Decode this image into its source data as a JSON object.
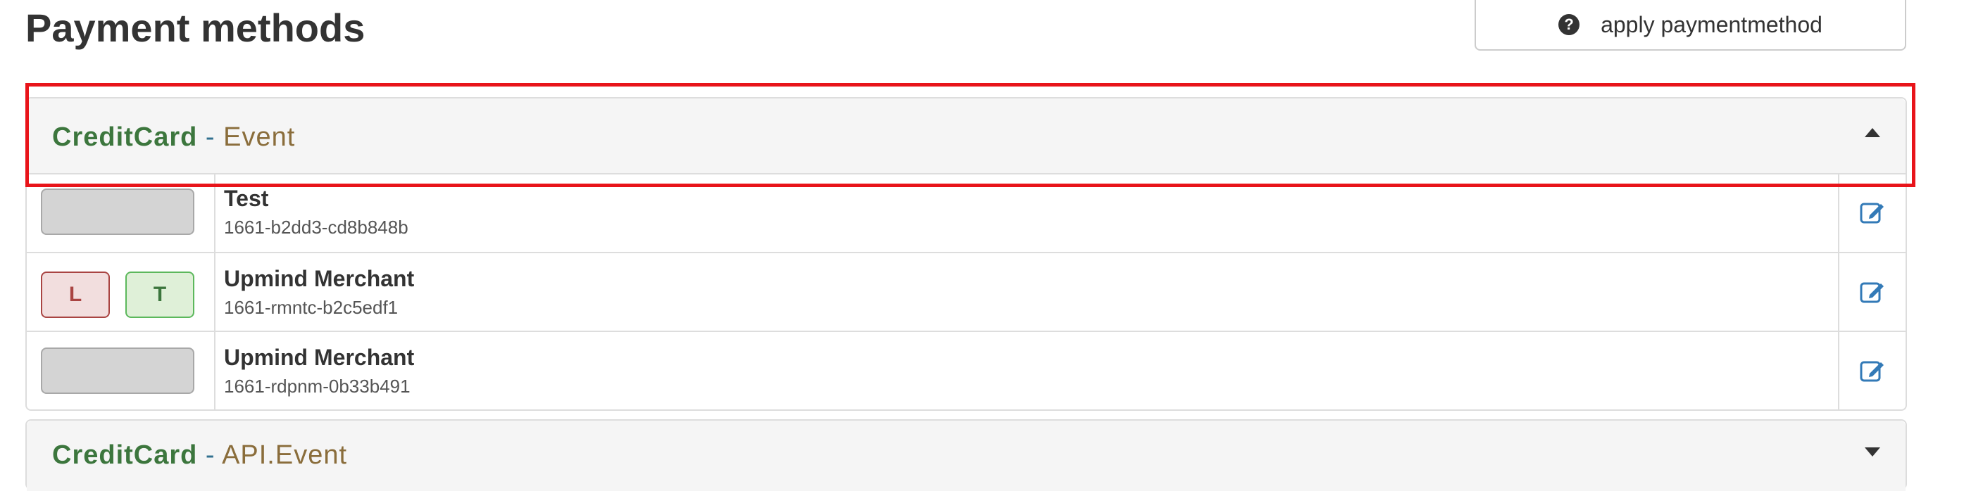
{
  "page": {
    "title": "Payment methods",
    "apply_button_label": "apply paymentmethod",
    "apply_button_icon": "question-circle-icon"
  },
  "panels": [
    {
      "type": "CreditCard",
      "separator": " - ",
      "kind": "Event",
      "expanded": true,
      "rows": [
        {
          "badges": [],
          "name": "Test",
          "id": "1661-b2dd3-cd8b848b"
        },
        {
          "badges": [
            "L",
            "T"
          ],
          "name": "Upmind Merchant",
          "id": "1661-rmntc-b2c5edf1"
        },
        {
          "badges": [],
          "name": "Upmind Merchant",
          "id": "1661-rdpnm-0b33b491"
        }
      ]
    },
    {
      "type": "CreditCard",
      "separator": " - ",
      "kind": "API.Event",
      "expanded": false,
      "rows": []
    }
  ],
  "colors": {
    "type_green": "#3c763d",
    "kind_brown": "#8a6d3b",
    "highlight_red": "#e8141a",
    "edit_blue": "#337ab7"
  }
}
